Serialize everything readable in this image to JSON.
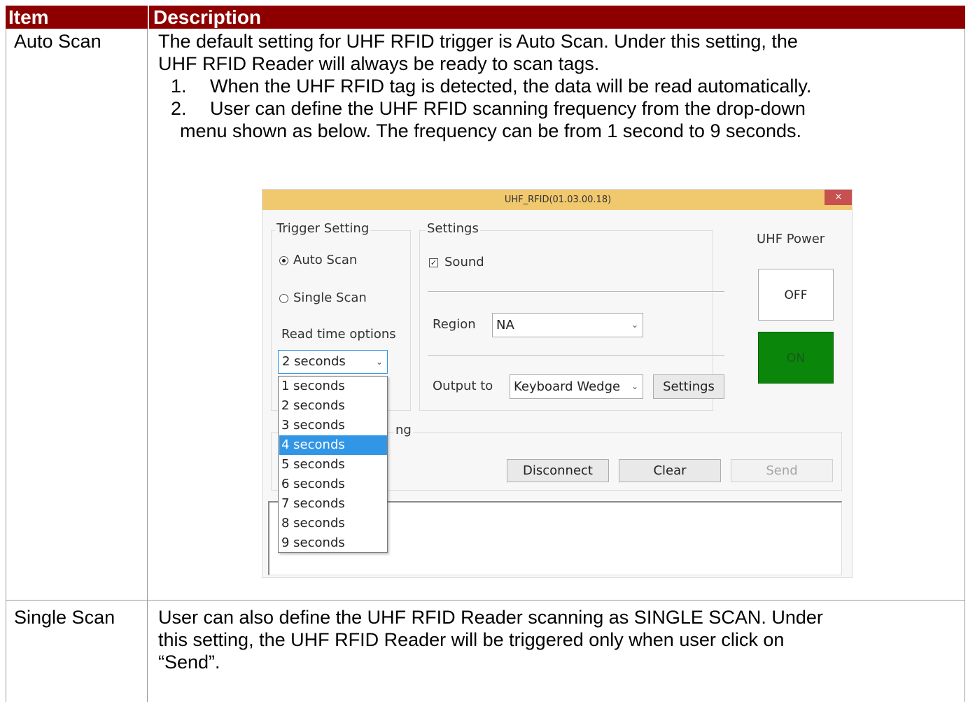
{
  "table": {
    "headers": {
      "item": "Item",
      "description": "Description"
    },
    "rows": [
      {
        "item": "Auto Scan",
        "intro_lines": [
          "The default setting for UHF RFID trigger is Auto Scan. Under this setting, the",
          "UHF RFID Reader will always be ready to scan tags."
        ],
        "list": [
          {
            "num": "1.",
            "text": "When the UHF RFID tag is detected, the data will be read automatically."
          },
          {
            "num": "2.",
            "text": "User can define the UHF RFID scanning frequency from the drop-down"
          }
        ],
        "list_continuation": "menu shown as below. The frequency can be from 1 second to 9 seconds."
      },
      {
        "item": "Single Scan",
        "lines": [
          "User can also define the UHF RFID Reader scanning as SINGLE SCAN. Under",
          "this setting, the UHF RFID Reader will be triggered only when user click on",
          "“Send”."
        ]
      }
    ]
  },
  "dialog": {
    "title": "UHF_RFID(01.03.00.18)",
    "close_glyph": "×",
    "trigger_setting": {
      "label": "Trigger Setting",
      "auto_scan": "Auto Scan",
      "single_scan": "Single Scan",
      "auto_scan_selected": true,
      "read_time_label": "Read time options",
      "read_time_value": "2 seconds",
      "read_time_options": [
        "1 seconds",
        "2 seconds",
        "3 seconds",
        "4 seconds",
        "5 seconds",
        "6 seconds",
        "7 seconds",
        "8 seconds",
        "9 seconds"
      ],
      "highlighted_option": "4 seconds"
    },
    "settings": {
      "label": "Settings",
      "sound_label": "Sound",
      "sound_checked": true,
      "region_label": "Region",
      "region_value": "NA",
      "output_label": "Output to",
      "output_value": "Keyboard Wedge",
      "settings_button": "Settings"
    },
    "power": {
      "label": "UHF Power",
      "off_label": "OFF",
      "on_label": "ON",
      "on_color": "#0a860a"
    },
    "partial_group_label": "ng",
    "buttons": {
      "disconnect": "Disconnect",
      "clear": "Clear",
      "send": "Send"
    },
    "accent_color": "#f0c86e"
  },
  "colors": {
    "header_bg": "#8e0000",
    "selection": "#3296e6"
  }
}
